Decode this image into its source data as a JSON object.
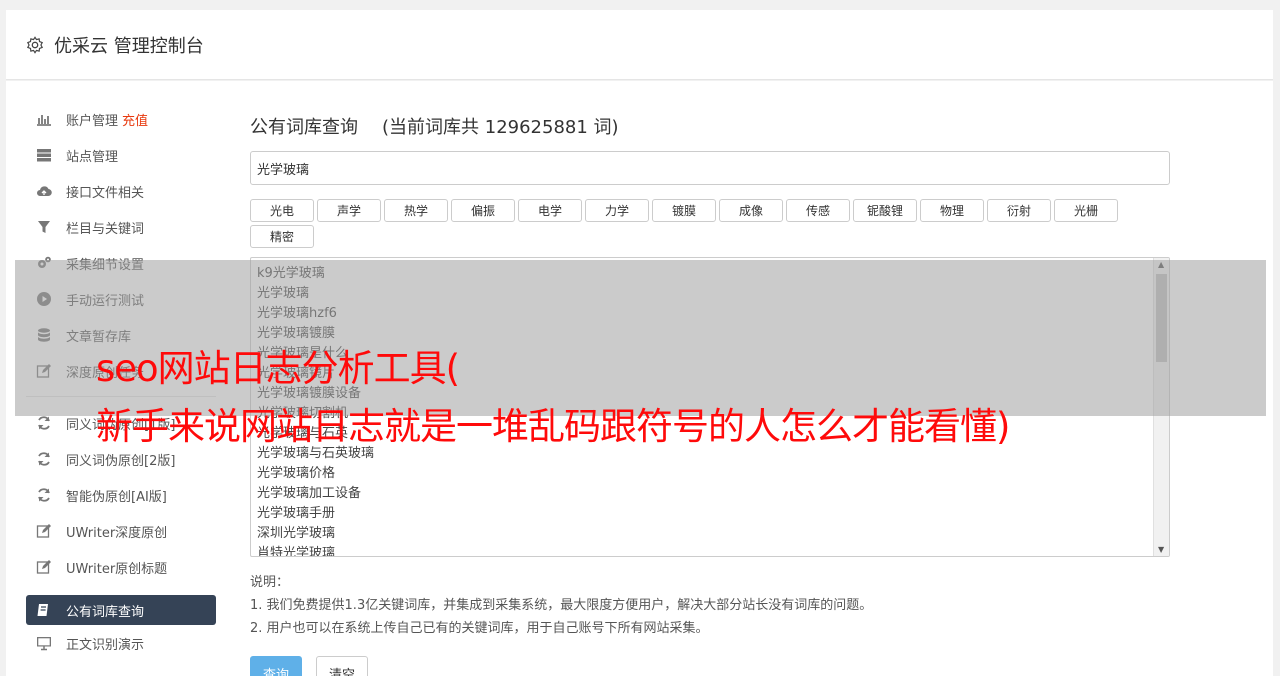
{
  "header": {
    "title": "优采云 管理控制台"
  },
  "sidebar": {
    "items": [
      {
        "label": "账户管理",
        "extra": "充值",
        "icon": "bar-chart-icon"
      },
      {
        "label": "站点管理",
        "icon": "server-icon"
      },
      {
        "label": "接口文件相关",
        "icon": "cloud-upload-icon"
      },
      {
        "label": "栏目与关键词",
        "icon": "filter-icon"
      },
      {
        "label": "采集细节设置",
        "icon": "gears-icon"
      },
      {
        "label": "手动运行测试",
        "icon": "play-circle-icon"
      },
      {
        "label": "文章暂存库",
        "icon": "database-icon"
      },
      {
        "label": "深度原创任务",
        "icon": "edit-icon"
      },
      {
        "label": "同义词伪原创[1版]",
        "icon": "refresh-icon"
      },
      {
        "label": "同义词伪原创[2版]",
        "icon": "refresh-icon"
      },
      {
        "label": "智能伪原创[AI版]",
        "icon": "refresh-icon"
      },
      {
        "label": "UWriter深度原创",
        "icon": "edit-icon"
      },
      {
        "label": "UWriter原创标题",
        "icon": "edit-icon"
      },
      {
        "label": "公有词库查询",
        "icon": "book-icon",
        "active": true
      },
      {
        "label": "正文识别演示",
        "icon": "monitor-icon"
      }
    ]
  },
  "content": {
    "title": "公有词库查询",
    "count_text": "(当前词库共 129625881 词)",
    "search_value": "光学玻璃",
    "tags": [
      "光电",
      "声学",
      "热学",
      "偏振",
      "电学",
      "力学",
      "镀膜",
      "成像",
      "传感",
      "铌酸锂",
      "物理",
      "衍射",
      "光栅",
      "精密"
    ],
    "results": [
      "k9光学玻璃",
      "光学玻璃",
      "光学玻璃hzf6",
      "光学玻璃镀膜",
      "光学玻璃是什么",
      "光学玻璃镜片",
      "光学玻璃镀膜设备",
      "光学玻璃切割机",
      "光学玻璃与石英",
      "光学玻璃与石英玻璃",
      "光学玻璃价格",
      "光学玻璃加工设备",
      "光学玻璃手册",
      "深圳光学玻璃",
      "肖特光学玻璃"
    ],
    "notes_title": "说明：",
    "notes": [
      "1. 我们免费提供1.3亿关键词库，并集成到采集系统，最大限度方便用户，解决大部分站长没有词库的问题。",
      "2. 用户也可以在系统上传自己已有的关键词库，用于自己账号下所有网站采集。"
    ],
    "query_button": "查询",
    "clear_button": "清空"
  },
  "overlay": {
    "line1": "seo网站日志分析工具(",
    "line2": "新手来说网站日志就是一堆乱码跟符号的人怎么才能看懂)"
  },
  "colors": {
    "accent": "#5fb0e8",
    "active_nav": "#354356",
    "recharge": "#e8390e",
    "caption": "#ff0a0a"
  }
}
